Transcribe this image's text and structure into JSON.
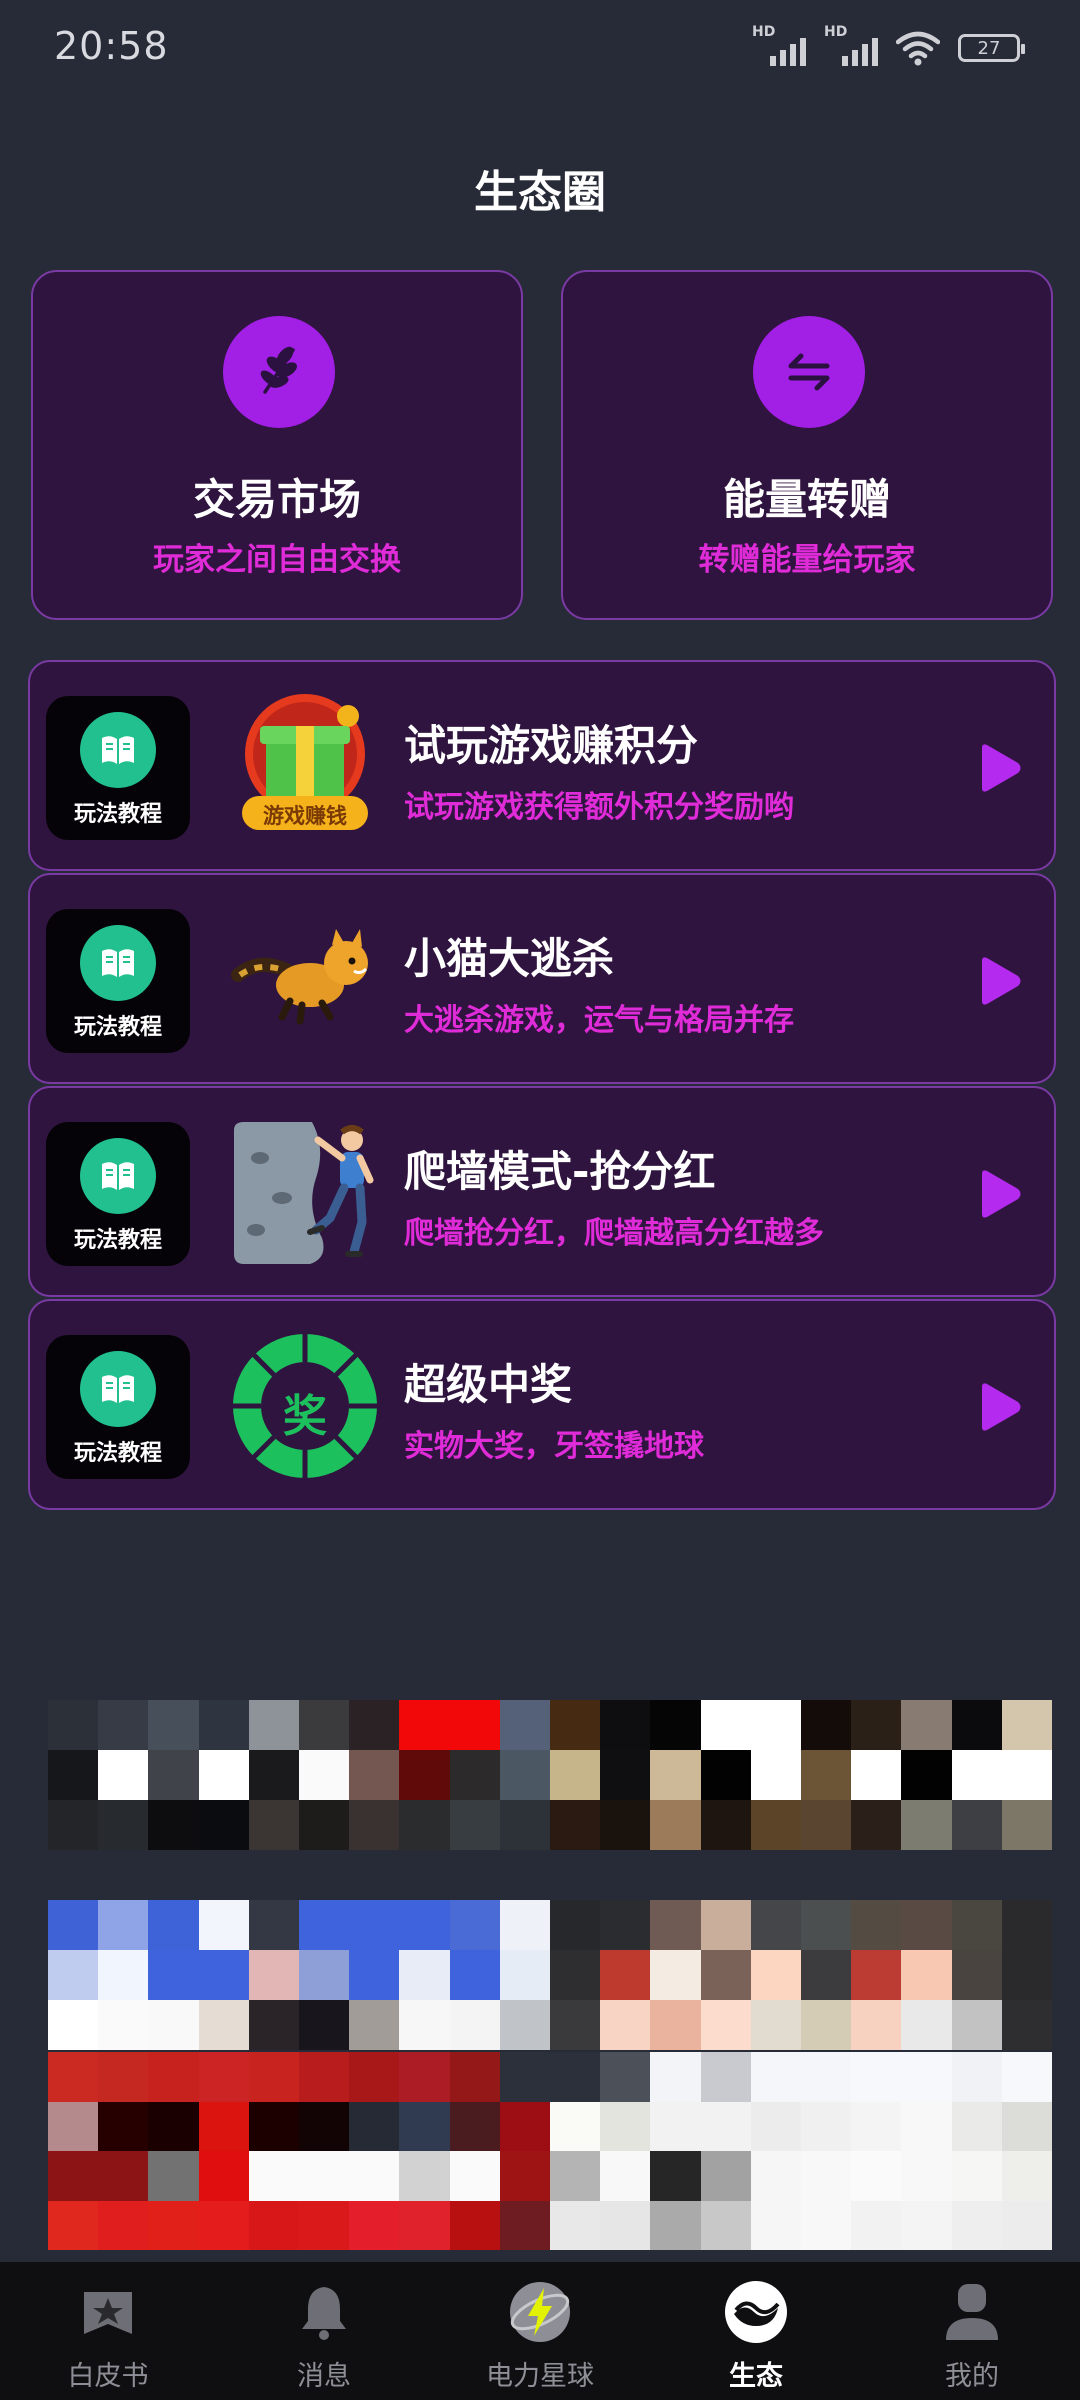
{
  "status_bar": {
    "time": "20:58",
    "battery": "27",
    "signal_tag": "HD"
  },
  "page": {
    "title": "生态圈"
  },
  "features": [
    {
      "title": "交易市场",
      "subtitle": "玩家之间自由交换",
      "icon": "leaf-icon"
    },
    {
      "title": "能量转赠",
      "subtitle": "转赠能量给玩家",
      "icon": "transfer-arrows-icon"
    }
  ],
  "games": [
    {
      "tutorial_label": "玩法教程",
      "thumb_text": "游戏赚钱",
      "title": "试玩游戏赚积分",
      "desc": "试玩游戏获得额外积分奖励哟",
      "icon": "gift-box-icon"
    },
    {
      "tutorial_label": "玩法教程",
      "title": "小猫大逃杀",
      "desc": "大逃杀游戏，运气与格局并存",
      "icon": "running-cat-icon"
    },
    {
      "tutorial_label": "玩法教程",
      "title": "爬墙模式-抢分红",
      "desc": "爬墙抢分红，爬墙越高分红越多",
      "icon": "climber-icon"
    },
    {
      "tutorial_label": "玩法教程",
      "thumb_text": "奖",
      "title": "超级中奖",
      "desc": "实物大奖，牙签撬地球",
      "icon": "prize-wheel-icon"
    }
  ],
  "colors": {
    "background": "#272a37",
    "card_bg": "#2f143f",
    "card_border": "#7a3aa3",
    "accent_purple": "#a21fe6",
    "magenta_text": "#e02bd8",
    "tutorial_green": "#21c08e",
    "play_purple": "#b42bef"
  },
  "banners": [
    {
      "cols": 20,
      "rows": 3,
      "cells": [
        "#2c3039",
        "#363b45",
        "#47505a",
        "#2f3540",
        "#8e9299",
        "#3b3b3d",
        "#2a2224",
        "#f20808",
        "#f20808",
        "#546178",
        "#472a12",
        "#0e0e10",
        "#050505",
        "#ffffff",
        "#ffffff",
        "#130c08",
        "#2b2018",
        "#877b72",
        "#0b0a0c",
        "#d3c6ad",
        "#16171a",
        "#ffffff",
        "#404349",
        "#ffffff",
        "#1a1a1c",
        "#fafafa",
        "#735750",
        "#600a0a",
        "#2c2a2a",
        "#4b5763",
        "#c6b48a",
        "#0f0f12",
        "#cdb898",
        "#020202",
        "#ffffff",
        "#6b5536",
        "#ffffff",
        "#020202",
        "#ffffff",
        "#ffffff",
        "#232528",
        "#272b30",
        "#0d0d0f",
        "#0a0c10",
        "#3b3634",
        "#1d1c1b",
        "#3a3230",
        "#2a2c2e",
        "#383d42",
        "#2d3238",
        "#2a1a12",
        "#1a120c",
        "#9c7b5a",
        "#1e1410",
        "#5c4428",
        "#5a4630",
        "#2b2019",
        "#7c7c70",
        "#3d3f44",
        "#7c7766"
      ]
    },
    {
      "cols": 20,
      "rows": 3,
      "cells": [
        "#3f63d6",
        "#8ea4e6",
        "#3e63d9",
        "#f2f5fb",
        "#333844",
        "#3e63dd",
        "#3e63dd",
        "#3e63dd",
        "#4a6bd6",
        "#eef2f8",
        "#26282c",
        "#2a2c30",
        "#6f5b54",
        "#c9ae9b",
        "#45464a",
        "#4c4f50",
        "#544b43",
        "#5a4a44",
        "#4a4640",
        "#2a2a2c",
        "#bfcbef",
        "#f1f5fe",
        "#3e63dd",
        "#3e63dd",
        "#e2b6b4",
        "#8e9ed6",
        "#3e63dd",
        "#e8ecf6",
        "#3e63dd",
        "#e6ecf6",
        "#2e2e30",
        "#be3a2e",
        "#f4ece2",
        "#7a6258",
        "#fcd6c0",
        "#3c3c3e",
        "#bc3c34",
        "#f8c8b2",
        "#4a4440",
        "#2a2a2c",
        "#ffffff",
        "#fafafa",
        "#f9f9f9",
        "#e5ddd3",
        "#2a2428",
        "#18161c",
        "#a29c98",
        "#f7f7f7",
        "#f4f4f4",
        "#c0c3c8",
        "#3a3a3c",
        "#f8d4c4",
        "#e9b39d",
        "#fcdccc",
        "#e2dcd0",
        "#d4ccb4",
        "#f7d2c0",
        "#e9e9ea",
        "#c2c2c2",
        "#2e2e30"
      ]
    },
    {
      "cols": 20,
      "rows": 4,
      "cells": [
        "#cb2a22",
        "#c52820",
        "#c8221e",
        "#cc2424",
        "#c8231f",
        "#b81c1c",
        "#a81818",
        "#ac1c24",
        "#941818",
        "#2c303a",
        "#2c303a",
        "#4c5058",
        "#f2f4f8",
        "#c8cad0",
        "#f4f6fa",
        "#f4f6fa",
        "#f6f8fb",
        "#f6f8fb",
        "#f0f2f6",
        "#f6f8fb",
        "#b48a8c",
        "#260000",
        "#1a0000",
        "#dc1410",
        "#1c0000",
        "#120404",
        "#262a34",
        "#303a50",
        "#4a1c20",
        "#9c0e14",
        "#fafaf6",
        "#e4e4de",
        "#f2f2f2",
        "#f2f2f2",
        "#ececec",
        "#f0f0f0",
        "#f4f4f4",
        "#f8f8f8",
        "#eaeae8",
        "#dcdcd8",
        "#8c1414",
        "#8c1414",
        "#727272",
        "#e00e0e",
        "#fafafa",
        "#fafafa",
        "#fafafa",
        "#d2d2d2",
        "#fafafa",
        "#9e1414",
        "#b4b4b4",
        "#f8f8f8",
        "#262626",
        "#a2a2a2",
        "#f6f6f6",
        "#f8f8f8",
        "#fafafa",
        "#f8f8f8",
        "#f6f6f4",
        "#eeeeea",
        "#e0281e",
        "#e01e1e",
        "#e2201a",
        "#e41c1c",
        "#d81818",
        "#da1a1a",
        "#e41e2a",
        "#e0222c",
        "#b81010",
        "#6e1c22",
        "#e8e8e8",
        "#e6e6e6",
        "#aaaaaa",
        "#c8c8c8",
        "#f6f6f6",
        "#f8f8f8",
        "#f2f2f2",
        "#f4f4f4",
        "#eeeeee",
        "#ececec"
      ]
    }
  ],
  "nav": [
    {
      "label": "白皮书",
      "icon": "whitepaper-book-icon",
      "active": false
    },
    {
      "label": "消息",
      "icon": "bell-icon",
      "active": false
    },
    {
      "label": "电力星球",
      "icon": "lightning-planet-icon",
      "active": false
    },
    {
      "label": "生态",
      "icon": "ecology-wave-icon",
      "active": true
    },
    {
      "label": "我的",
      "icon": "user-icon",
      "active": false
    }
  ]
}
